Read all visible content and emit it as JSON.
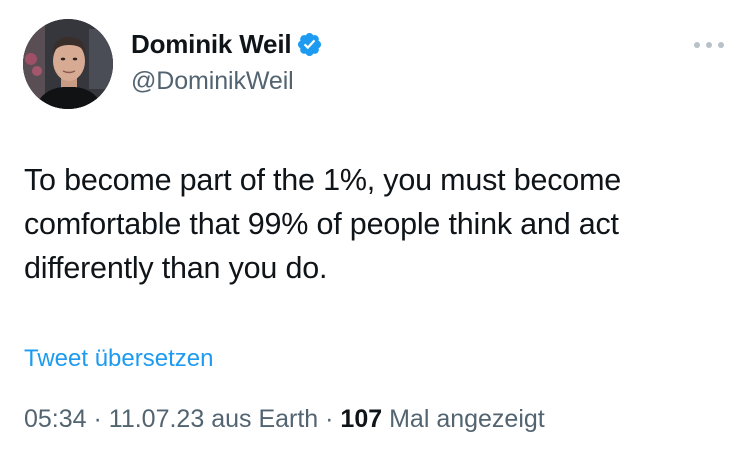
{
  "author": {
    "display_name": "Dominik Weil",
    "handle": "@DominikWeil",
    "verified": true
  },
  "tweet": {
    "text": "To become part of the 1%, you must become comfortable that 99% of people think and act differently than you do.",
    "translate_label": "Tweet übersetzen"
  },
  "meta": {
    "time": "05:34",
    "sep1": " · ",
    "date": "11.07.23",
    "source": " aus Earth",
    "sep2": " · ",
    "views_count": "107",
    "views_label": " Mal angezeigt"
  },
  "colors": {
    "verified_badge": "#1d9bf0",
    "link": "#1d9bf0",
    "secondary_text": "#536471"
  },
  "icons": {
    "more": "more-horizontal-icon",
    "verified": "verified-badge-icon"
  }
}
